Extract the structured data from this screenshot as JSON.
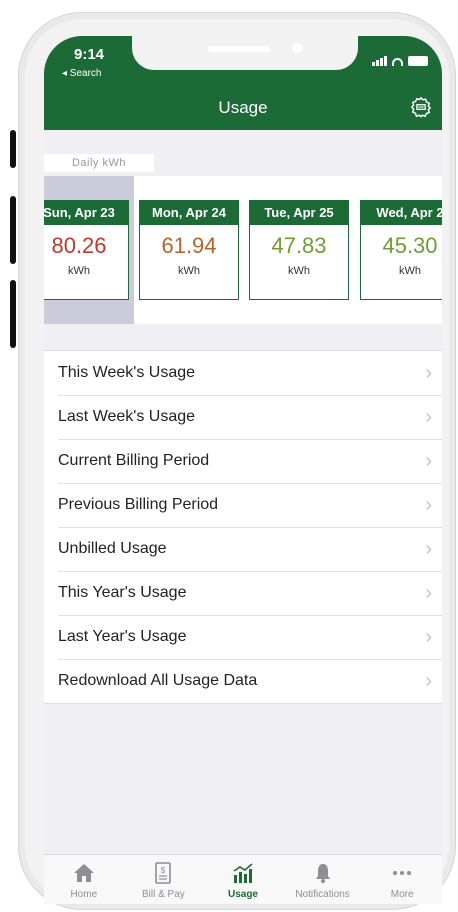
{
  "status_bar": {
    "time": "9:14",
    "back_app": "◂ Search"
  },
  "nav": {
    "title": "Usage",
    "settings_icon": "settings-gear-icon"
  },
  "daily_section": {
    "label": "Daily kWh"
  },
  "days": [
    {
      "date": "Sun, Apr 23",
      "value": "80.26",
      "unit": "kWh",
      "color": "#c0392b"
    },
    {
      "date": "Mon, Apr 24",
      "value": "61.94",
      "unit": "kWh",
      "color": "#b5652a"
    },
    {
      "date": "Tue, Apr 25",
      "value": "47.83",
      "unit": "kWh",
      "color": "#6e9e33"
    },
    {
      "date": "Wed, Apr 2",
      "value": "45.30",
      "unit": "kWh",
      "color": "#6e9e33"
    }
  ],
  "usage_list": [
    {
      "label": "This Week's Usage"
    },
    {
      "label": "Last Week's Usage"
    },
    {
      "label": "Current Billing Period"
    },
    {
      "label": "Previous Billing Period"
    },
    {
      "label": "Unbilled Usage"
    },
    {
      "label": "This Year's Usage"
    },
    {
      "label": "Last Year's Usage"
    },
    {
      "label": "Redownload All Usage Data"
    }
  ],
  "tabs": [
    {
      "label": "Home",
      "icon": "home-icon"
    },
    {
      "label": "Bill & Pay",
      "icon": "bill-icon"
    },
    {
      "label": "Usage",
      "icon": "usage-chart-icon"
    },
    {
      "label": "Notifications",
      "icon": "bell-icon"
    },
    {
      "label": "More",
      "icon": "more-icon"
    }
  ],
  "colors": {
    "brand_green": "#1c6a36",
    "selected_day_bg": "#cbcbd9"
  }
}
